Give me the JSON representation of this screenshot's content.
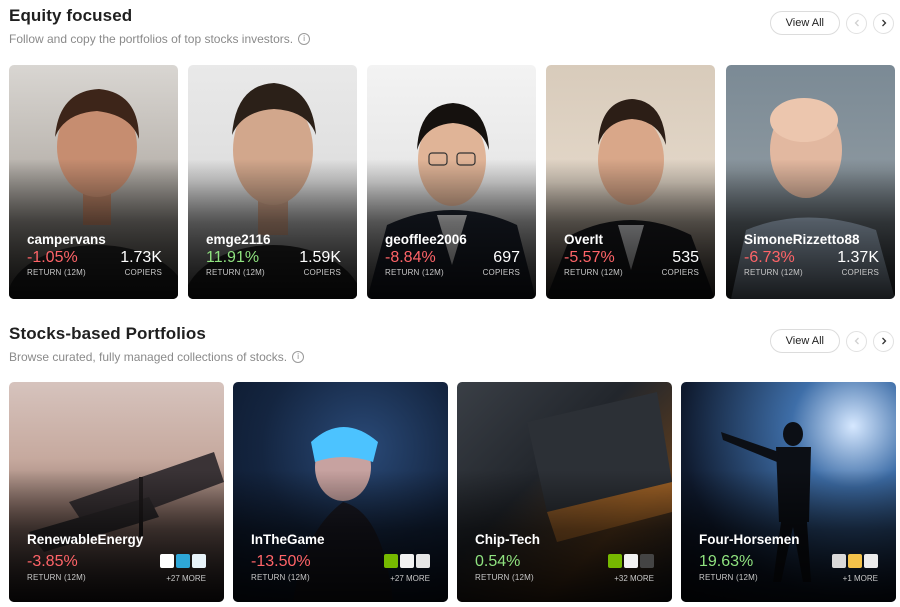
{
  "equity": {
    "title": "Equity focused",
    "subtitle": "Follow and copy the portfolios of top stocks investors.",
    "view_all": "View All",
    "cards": [
      {
        "name": "campervans",
        "return": "-1.05%",
        "return_label": "RETURN (12M)",
        "copiers": "1.73K",
        "copiers_label": "COPIERS"
      },
      {
        "name": "emge2116",
        "return": "11.91%",
        "return_label": "RETURN (12M)",
        "copiers": "1.59K",
        "copiers_label": "COPIERS"
      },
      {
        "name": "geofflee2006",
        "return": "-8.84%",
        "return_label": "RETURN (12M)",
        "copiers": "697",
        "copiers_label": "COPIERS"
      },
      {
        "name": "OverIt",
        "return": "-5.57%",
        "return_label": "RETURN (12M)",
        "copiers": "535",
        "copiers_label": "COPIERS"
      },
      {
        "name": "SimoneRizzetto88",
        "return": "-6.73%",
        "return_label": "RETURN (12M)",
        "copiers": "1.37K",
        "copiers_label": "COPIERS"
      }
    ]
  },
  "stocks": {
    "title": "Stocks-based Portfolios",
    "subtitle": "Browse curated, fully managed collections of stocks.",
    "view_all": "View All",
    "cards": [
      {
        "name": "RenewableEnergy",
        "return": "-3.85%",
        "return_label": "RETURN (12M)",
        "more": "+27 MORE"
      },
      {
        "name": "InTheGame",
        "return": "-13.50%",
        "return_label": "RETURN (12M)",
        "more": "+27 MORE"
      },
      {
        "name": "Chip-Tech",
        "return": "0.54%",
        "return_label": "RETURN (12M)",
        "more": "+32 MORE"
      },
      {
        "name": "Four-Horsemen",
        "return": "19.63%",
        "return_label": "RETURN (12M)",
        "more": "+1 MORE"
      }
    ]
  },
  "colors": {
    "negative": "#ff6468",
    "positive": "#8fe27f"
  },
  "icons": {
    "info": "info-circle-icon",
    "prev": "chevron-left-icon",
    "next": "chevron-right-icon"
  }
}
